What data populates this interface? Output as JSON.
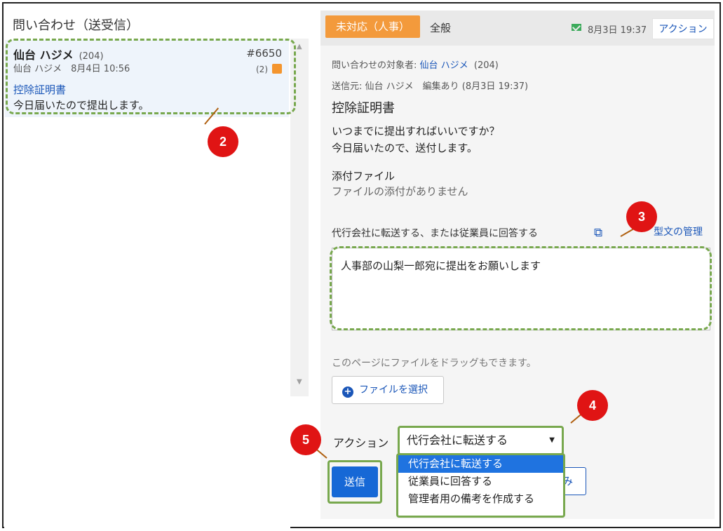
{
  "left_panel": {
    "title": "問い合わせ（送受信）",
    "message": {
      "name": "仙台 ハジメ",
      "name_id": "(204)",
      "sub": "仙台 ハジメ　8月4日 10:56",
      "number": "#6650",
      "count": "(2)",
      "subject": "控除証明書",
      "body": "今日届いたので提出します。"
    }
  },
  "header": {
    "status": "未対応（人事）",
    "category": "全般",
    "date": "8月3日 19:37",
    "action_button": "アクション"
  },
  "detail": {
    "target_label": "問い合わせの対象者: ",
    "target_name": "仙台 ハジメ",
    "target_id": "(204)",
    "sender_line": "送信元: 仙台 ハジメ　編集あり (8月3日 19:37)",
    "title": "控除証明書",
    "body_line1": "いつまでに提出すればいいですか？",
    "body_line2": "今日届いたので、送付します。",
    "attach_label": "添付ファイル",
    "attach_none": "ファイルの添付がありません"
  },
  "reply": {
    "label": "代行会社に転送する、または従業員に回答する",
    "template_link": "型文の管理",
    "text": "人事部の山梨一郎宛に提出をお願いします",
    "drag_hint": "このページにファイルをドラッグもできます。",
    "file_button": "ファイルを選択"
  },
  "action": {
    "label": "アクション",
    "selected": "代行会社に転送する",
    "options": [
      "代行会社に転送する",
      "従業員に回答する",
      "管理者用の備考を作成する"
    ],
    "behind_button_fragment": "み",
    "send_button": "送信"
  },
  "badges": [
    "2",
    "3",
    "4",
    "5"
  ],
  "colors": {
    "accent_blue": "#1668d6",
    "status_orange": "#f39a3c",
    "highlight_green": "#78a84e",
    "badge_red": "#e01414"
  }
}
